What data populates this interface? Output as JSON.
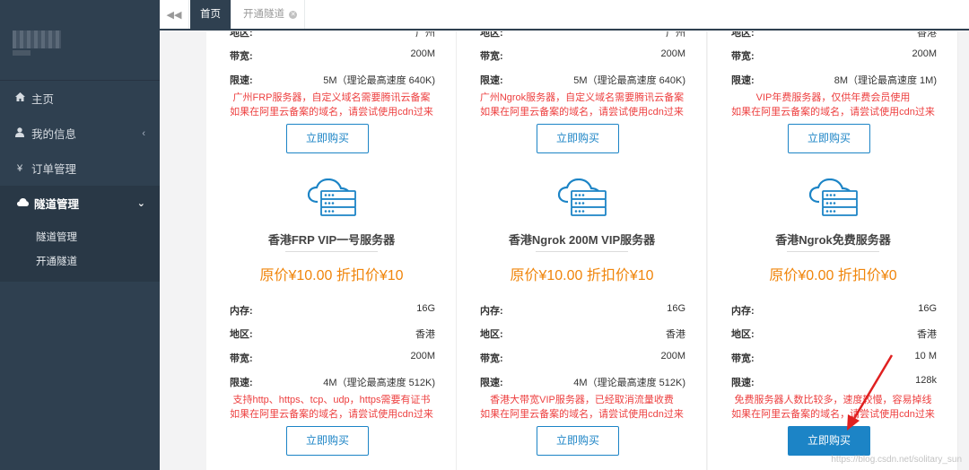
{
  "sidebar": {
    "items": [
      {
        "label": "主页",
        "icon": "home-icon"
      },
      {
        "label": "我的信息",
        "icon": "user-icon"
      },
      {
        "label": "订单管理",
        "icon": "yen-icon"
      },
      {
        "label": "隧道管理",
        "icon": "cloud-icon"
      }
    ],
    "subitems": [
      {
        "label": "隧道管理"
      },
      {
        "label": "开通隧道"
      }
    ]
  },
  "tabs": {
    "home": "首页",
    "open": "开通隧道"
  },
  "labels": {
    "memory": "内存:",
    "region": "地区:",
    "bandwidth": "带宽:",
    "speed": "限速:",
    "buy": "立即购买"
  },
  "top_cards": [
    {
      "region": "广州",
      "bandwidth": "200M",
      "speed": "5M（理论最高速度 640K)",
      "note1": "广州FRP服务器，自定义域名需要腾讯云备案",
      "note2": "如果在阿里云备案的域名，请尝试使用cdn过来"
    },
    {
      "region": "广州",
      "bandwidth": "200M",
      "speed": "5M（理论最高速度 640K)",
      "note1": "广州Ngrok服务器，自定义域名需要腾讯云备案",
      "note2": "如果在阿里云备案的域名，请尝试使用cdn过来"
    },
    {
      "region": "香港",
      "bandwidth": "200M",
      "speed": "8M（理论最高速度 1M)",
      "note1": "VIP年费服务器，仅供年费会员使用",
      "note2": "如果在阿里云备案的域名，请尝试使用cdn过来"
    }
  ],
  "cards": [
    {
      "title": "香港FRP VIP一号服务器",
      "price": "原价¥10.00   折扣价¥10",
      "memory": "16G",
      "region": "香港",
      "bandwidth": "200M",
      "speed": "4M（理论最高速度 512K)",
      "note1": "支持http、https、tcp、udp，https需要有证书",
      "note2": "如果在阿里云备案的域名，请尝试使用cdn过来"
    },
    {
      "title": "香港Ngrok 200M VIP服务器",
      "price": "原价¥10.00   折扣价¥10",
      "memory": "16G",
      "region": "香港",
      "bandwidth": "200M",
      "speed": "4M（理论最高速度 512K)",
      "note1": "香港大带宽VIP服务器，已经取消流量收费",
      "note2": "如果在阿里云备案的域名，请尝试使用cdn过来"
    },
    {
      "title": "香港Ngrok免费服务器",
      "price": "原价¥0.00   折扣价¥0",
      "memory": "16G",
      "region": "香港",
      "bandwidth": "10 M",
      "speed": "128k",
      "note1": "免费服务器人数比较多，速度较慢，容易掉线",
      "note2": "如果在阿里云备案的域名，请尝试使用cdn过来"
    }
  ],
  "watermark": "https://blog.csdn.net/solitary_sun",
  "colors": {
    "sidebar": "#2f4050",
    "accent": "#1c84c6",
    "price": "#f0850b",
    "note": "#ed3f3f",
    "annotation": "#e02020"
  }
}
